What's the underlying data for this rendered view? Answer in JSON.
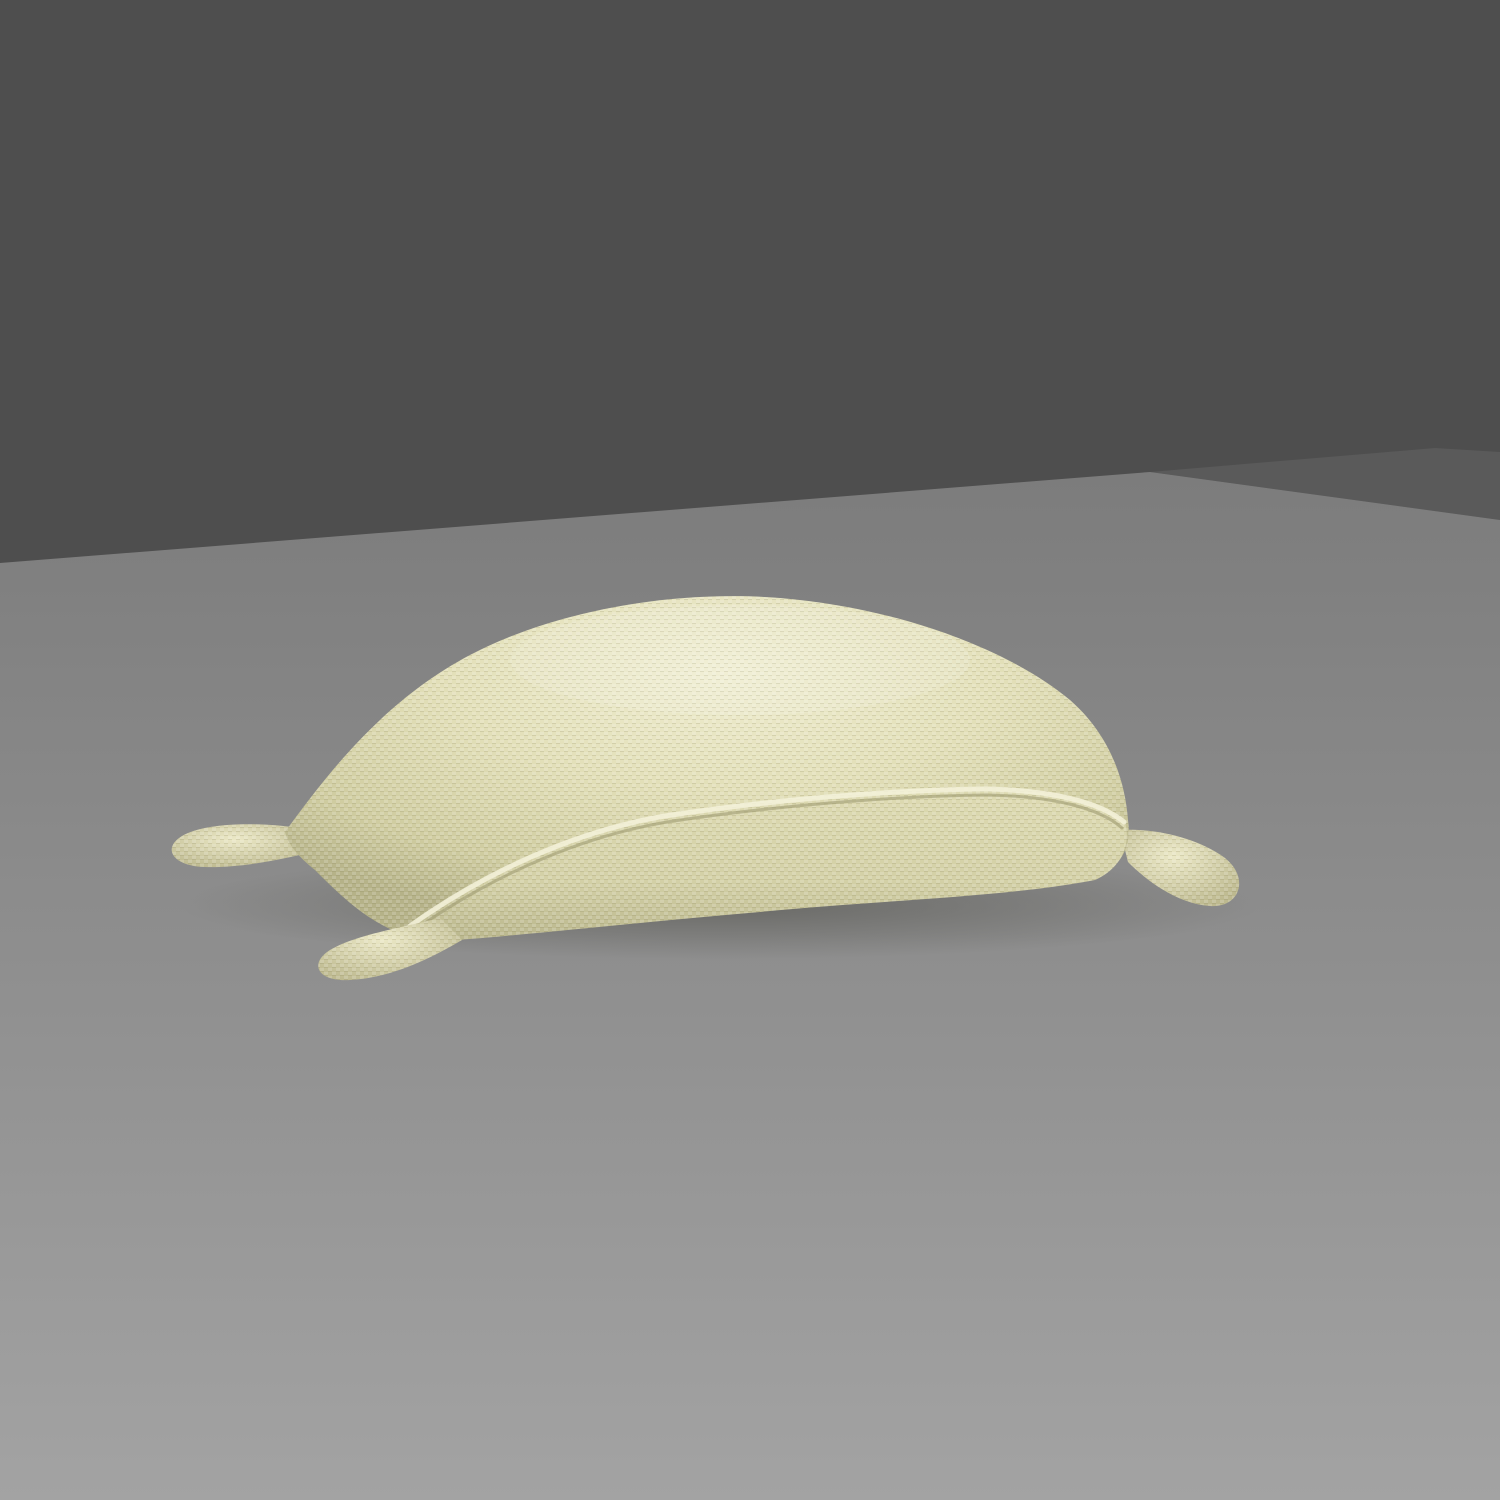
{
  "scene": {
    "subject": "burlap-sack",
    "colors": {
      "background_wall": "#4e4e4e",
      "floor_far": "#7b7b7b",
      "floor_near": "#a2a2a2",
      "floor_right_step": "#5a5a5a",
      "sack_light": "#eeeccd",
      "sack_mid": "#dcd9b0",
      "sack_dark": "#a9a67d",
      "sack_shadow": "#5f5f56"
    }
  }
}
